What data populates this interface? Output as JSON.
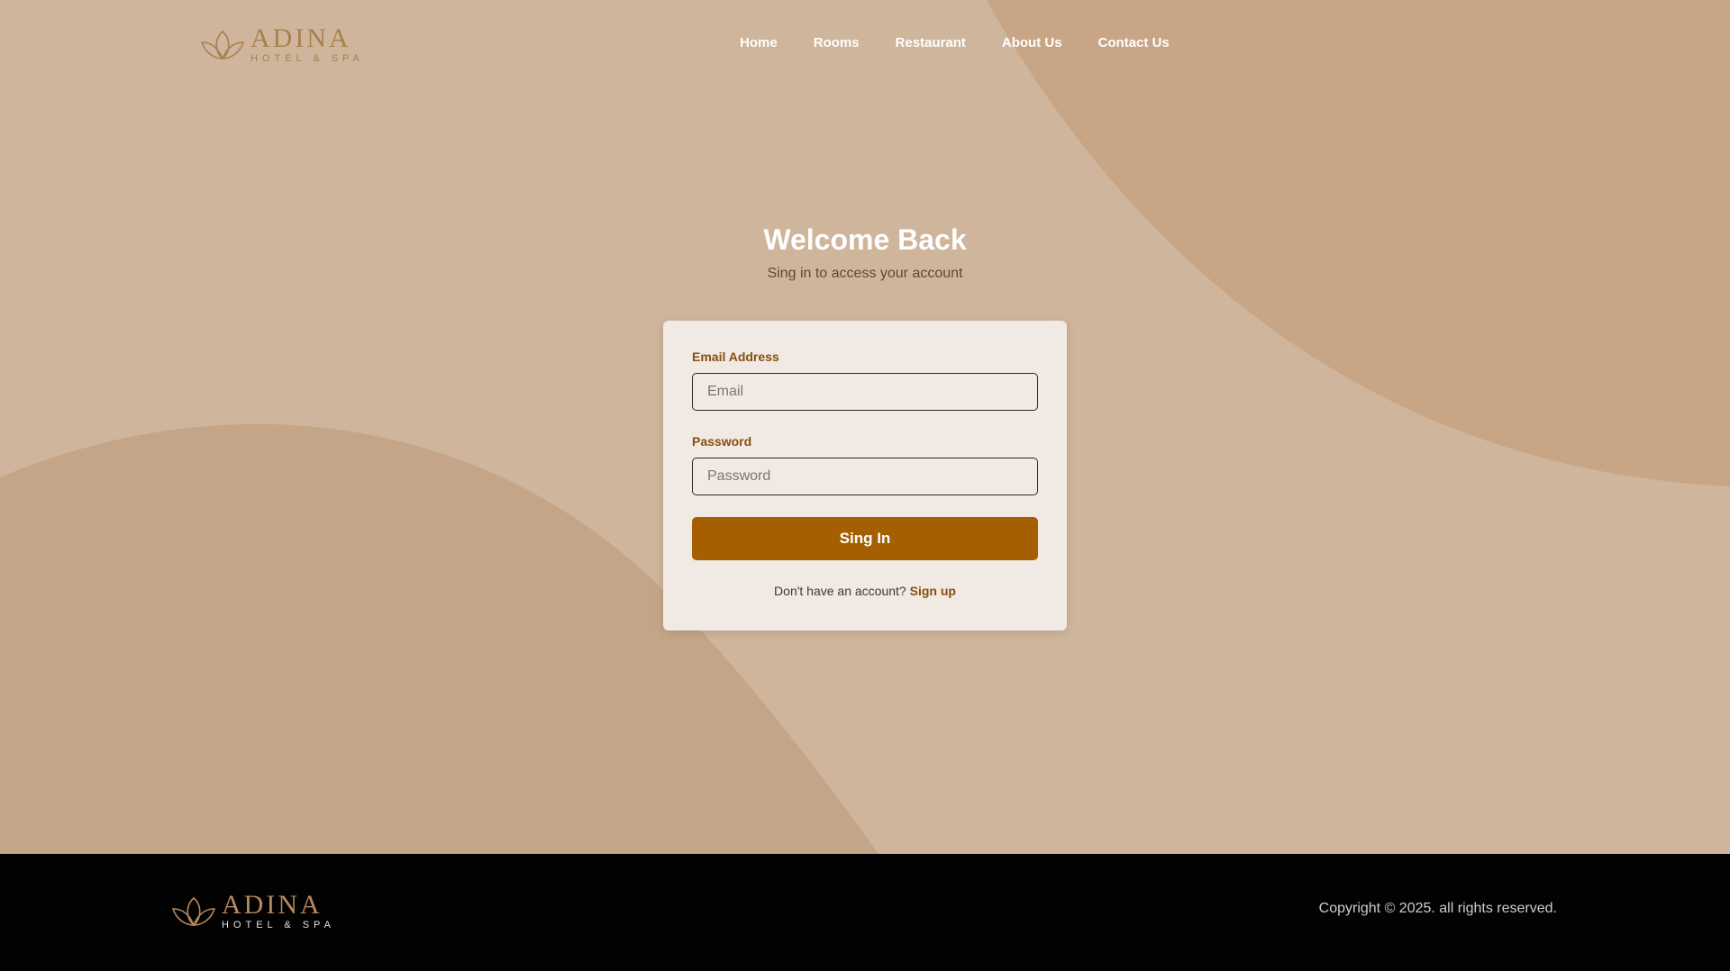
{
  "brand": {
    "name": "ADINA",
    "tagline": "HOTEL & SPA",
    "icon": "lotus-icon"
  },
  "nav": {
    "items": [
      {
        "label": "Home"
      },
      {
        "label": "Rooms"
      },
      {
        "label": "Restaurant"
      },
      {
        "label": "About Us"
      },
      {
        "label": "Contact Us"
      }
    ]
  },
  "login": {
    "title": "Welcome Back",
    "subtitle": "Sing in to access your account",
    "email_label": "Email Address",
    "email_placeholder": "Email",
    "email_value": "",
    "password_label": "Password",
    "password_placeholder": "Password",
    "password_value": "",
    "submit_label": "Sing In",
    "signup_prompt": "Don't have an account?",
    "signup_link": "Sign up"
  },
  "footer": {
    "copyright": "Copyright © 2025. all rights reserved."
  },
  "colors": {
    "hero_bg": "#cfb59b",
    "accent": "#a55f00",
    "label": "#8a4e0c",
    "card_bg": "#f0e9e4",
    "footer_bg": "#020202"
  }
}
